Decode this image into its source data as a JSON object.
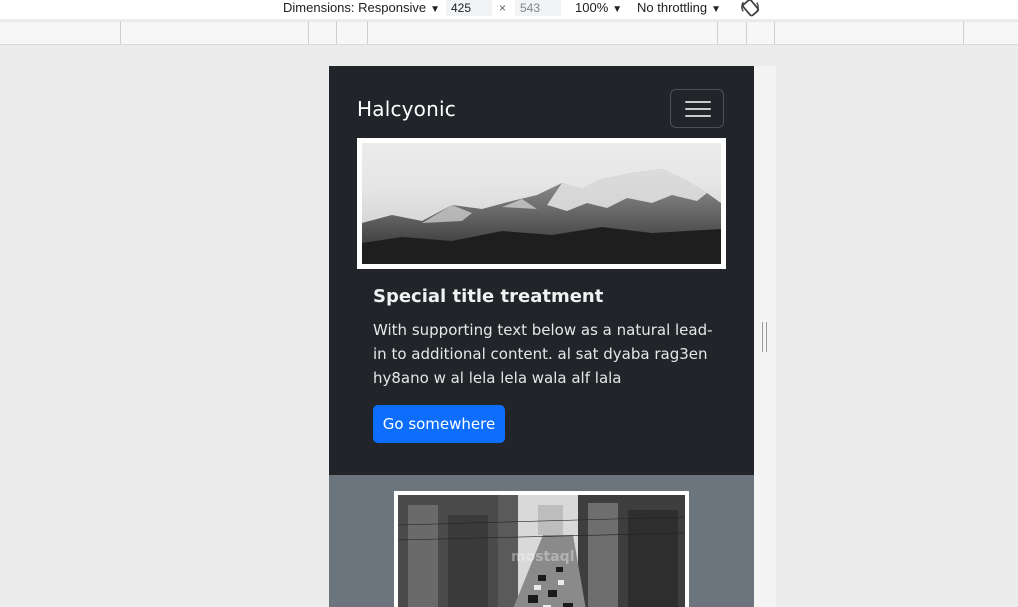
{
  "devtools": {
    "dimensions_label": "Dimensions: Responsive",
    "width_value": "425",
    "height_value": "543",
    "times_sign": "×",
    "zoom_label": "100%",
    "throttle_label": "No throttling",
    "caret": "▼",
    "rotate_icon": "rotate-icon"
  },
  "navbar": {
    "brand": "Halcyonic",
    "toggler_icon": "hamburger-icon"
  },
  "card": {
    "image_alt": "mountain landscape",
    "title": "Special title treatment",
    "text": "With supporting text below as a natural lead-in to additional content. al sat dyaba rag3en hy8ano w al lela lela wala alf lala",
    "button_label": "Go somewhere"
  },
  "section2": {
    "image_alt": "city street",
    "watermark": "mostaql"
  },
  "colors": {
    "dark_bg": "#212529",
    "secondary_bg": "#6c757d",
    "primary": "#0d6efd"
  }
}
